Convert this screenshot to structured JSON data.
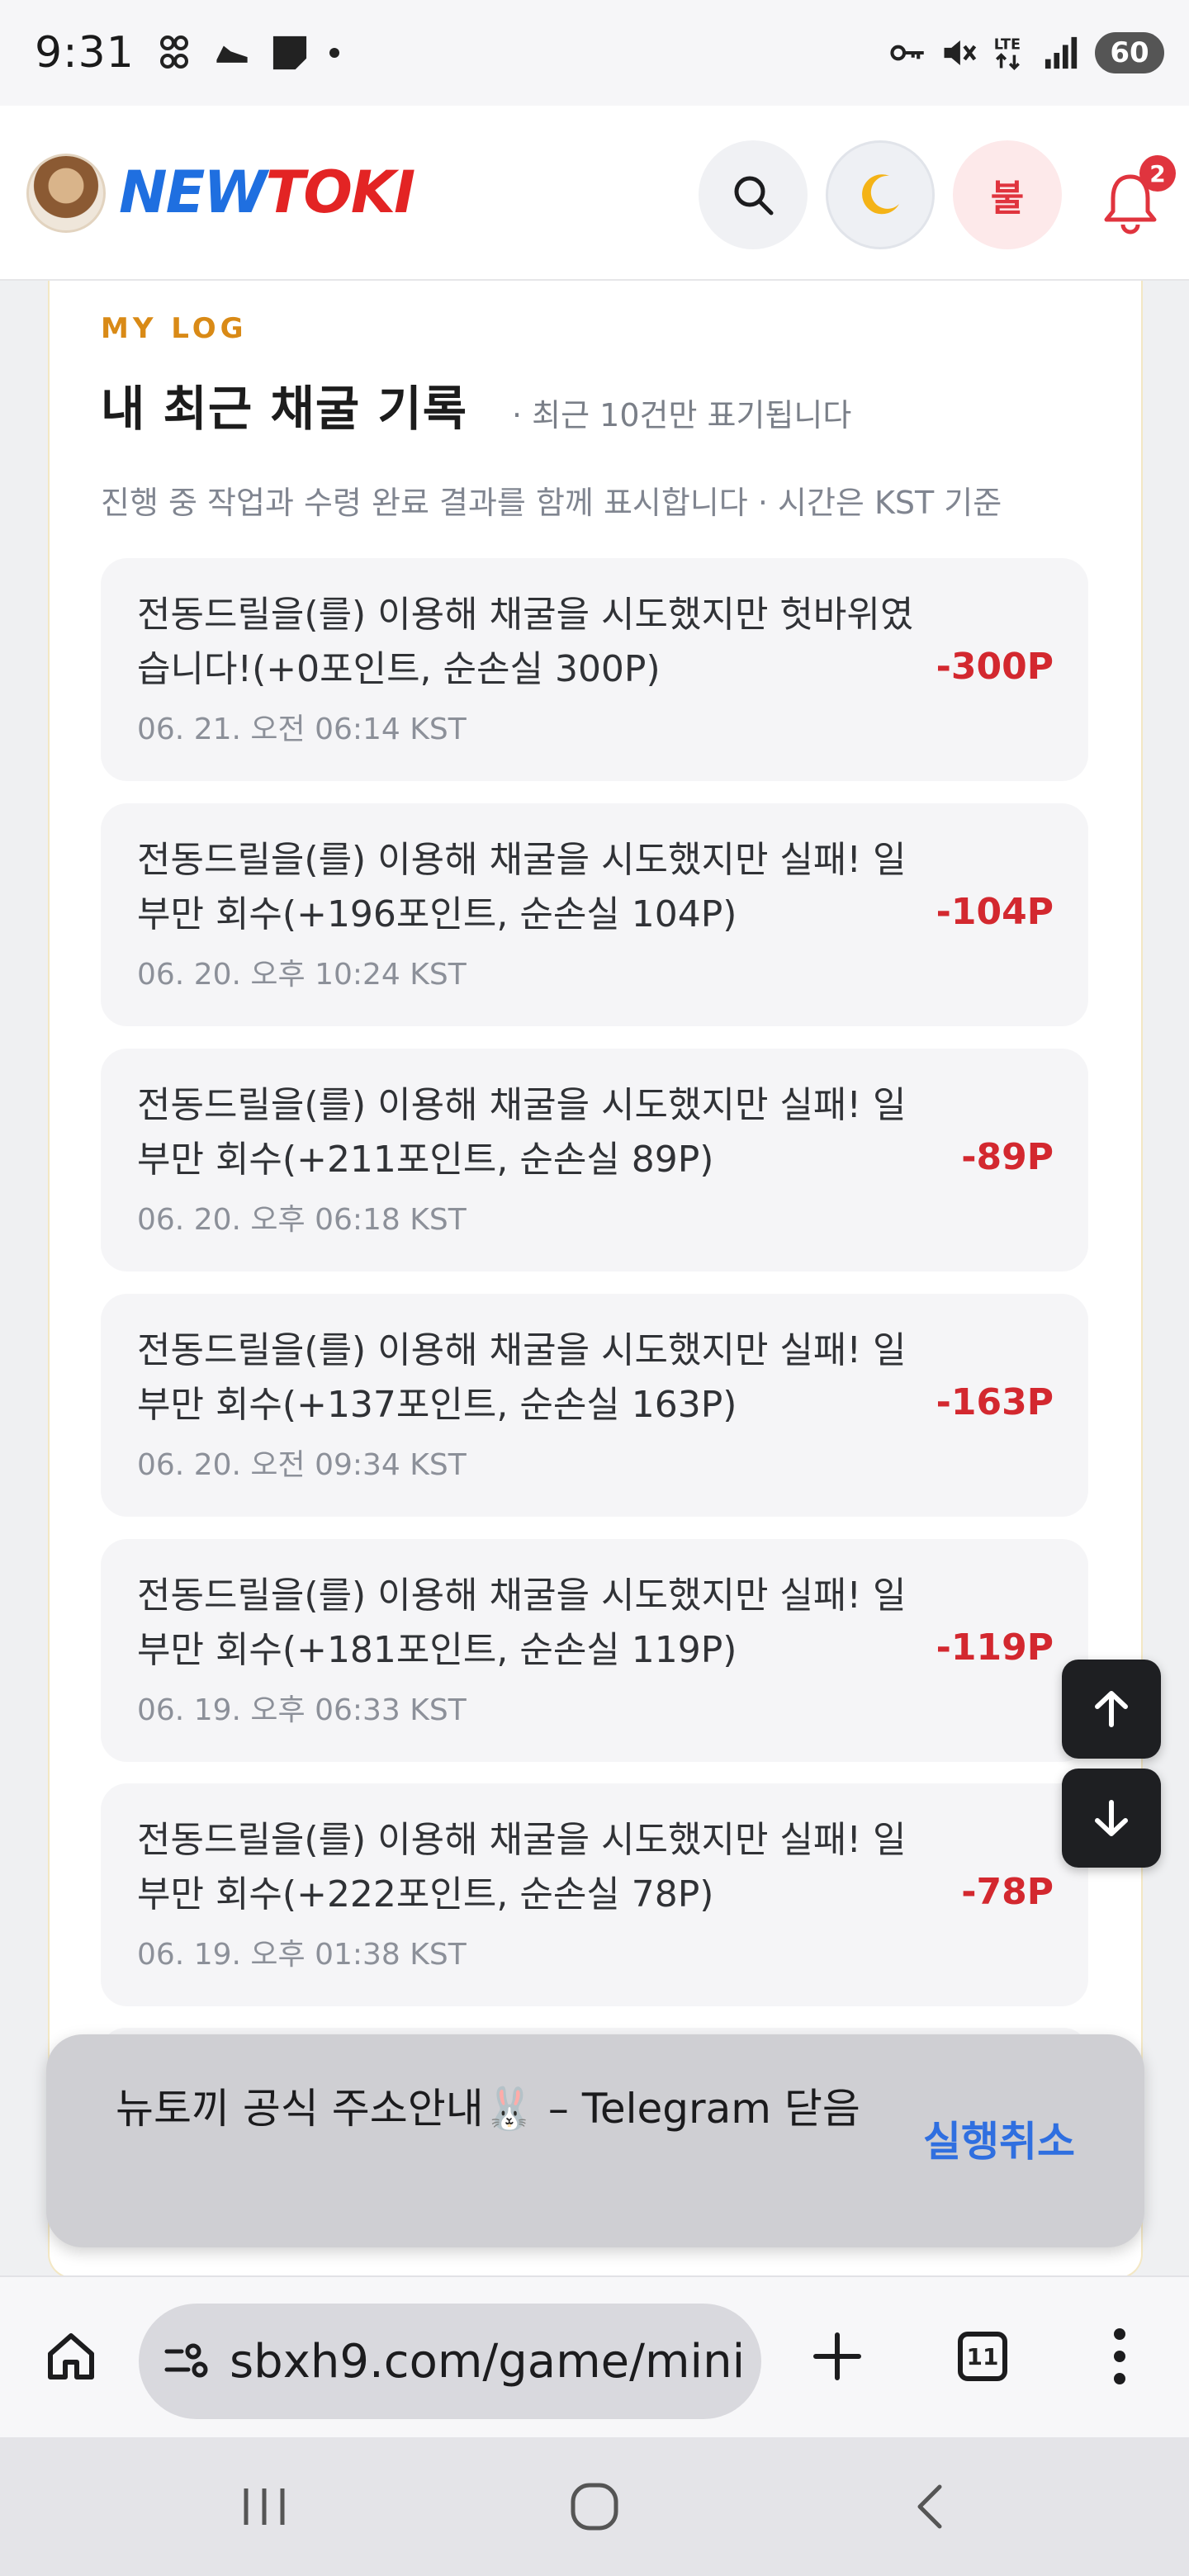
{
  "status_bar": {
    "time": "9:31",
    "network_label": "LTE",
    "battery": "60"
  },
  "header": {
    "logo_new": "NEW",
    "logo_toki": "TOKI",
    "fire_button_label": "불",
    "notification_count": "2"
  },
  "section": {
    "eyebrow": "MY LOG",
    "title": "내 최근 채굴 기록",
    "note": "· 최근 10건만 표기됩니다",
    "description": "진행 중 작업과 수령 완료 결과를 함께 표시합니다 · 시간은 KST 기준"
  },
  "logs": [
    {
      "message": "전동드릴을(를) 이용해 채굴을 시도했지만 헛바위였습니다!(+0포인트, 순손실 300P)",
      "time": "06. 21. 오전 06:14 KST",
      "amount": "-300P"
    },
    {
      "message": "전동드릴을(를) 이용해 채굴을 시도했지만 실패! 일부만 회수(+196포인트, 순손실 104P)",
      "time": "06. 20. 오후 10:24 KST",
      "amount": "-104P"
    },
    {
      "message": "전동드릴을(를) 이용해 채굴을 시도했지만 실패! 일부만 회수(+211포인트, 순손실 89P)",
      "time": "06. 20. 오후 06:18 KST",
      "amount": "-89P"
    },
    {
      "message": "전동드릴을(를) 이용해 채굴을 시도했지만 실패! 일부만 회수(+137포인트, 순손실 163P)",
      "time": "06. 20. 오전 09:34 KST",
      "amount": "-163P"
    },
    {
      "message": "전동드릴을(를) 이용해 채굴을 시도했지만 실패! 일부만 회수(+181포인트, 순손실 119P)",
      "time": "06. 19. 오후 06:33 KST",
      "amount": "-119P"
    },
    {
      "message": "전동드릴을(를) 이용해 채굴을 시도했지만 실패! 일부만 회수(+222포인트, 순손실 78P)",
      "time": "06. 19. 오후 01:38 KST",
      "amount": "-78P"
    }
  ],
  "snackbar": {
    "text": "뉴토끼 공식 주소안내🐰 – Telegram 닫음",
    "action": "실행취소"
  },
  "browser": {
    "url": "sbxh9.com/game/mini",
    "tab_count": "11"
  },
  "colors": {
    "accent_orange": "#d98a16",
    "loss_red": "#d3282f",
    "brand_blue": "#1f6fe0",
    "brand_red": "#e32424",
    "link_blue": "#2f6fe0"
  }
}
